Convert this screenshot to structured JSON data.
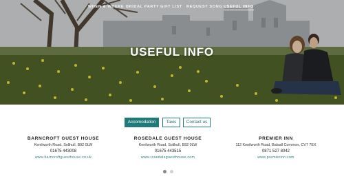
{
  "nav": {
    "items": [
      {
        "label": "When & Where"
      },
      {
        "label": "Bridal Party"
      },
      {
        "label": "Gift List"
      },
      {
        "label": "Request Song"
      },
      {
        "label": "Useful Info"
      }
    ],
    "active_index": 4
  },
  "hero": {
    "title": "USEFUL INFO"
  },
  "tabs": [
    {
      "label": "Accomodation"
    },
    {
      "label": "Taxis"
    },
    {
      "label": "Contact us"
    }
  ],
  "active_tab": 0,
  "accommodations": [
    {
      "name": "BARNCROFT GUEST HOUSE",
      "address": "Kenilworth Road, Solihull, B92 0LW",
      "phone": "01675 443008",
      "website": "www.barncroftguesthouse.co.uk"
    },
    {
      "name": "ROSEDALE GUEST HOUSE",
      "address": "Kenilworth Road, Solihull, B92 0LW",
      "phone": "01675 443515",
      "website": "www.rosedaleguesthouse.com"
    },
    {
      "name": "PREMIER INN",
      "address": "112 Kenilworth Road, Balsall Common, CV7 7EX",
      "phone": "0871 527 8042",
      "website": "www.premierinn.com"
    }
  ],
  "carousel": {
    "pages": 2,
    "active_page": 1
  },
  "colors": {
    "accent": "#1f7a78",
    "link": "#2a7c79",
    "dot_active": "#8a8a8a",
    "dot_inactive": "#cfcfcf"
  }
}
